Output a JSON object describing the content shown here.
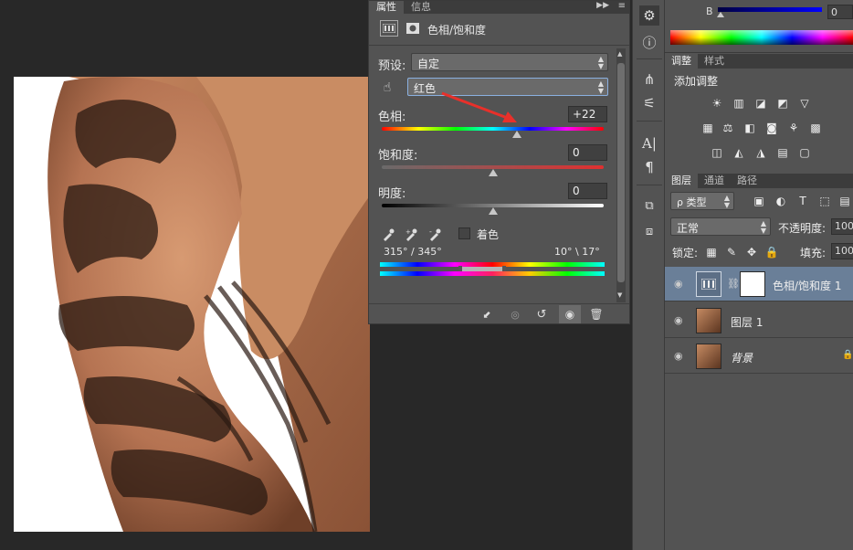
{
  "properties_panel": {
    "tabs": [
      "属性",
      "信息"
    ],
    "title": "色相/饱和度",
    "preset_label": "预设:",
    "preset_value": "自定",
    "channel_value": "红色",
    "hue_label": "色相:",
    "hue_value": "+22",
    "saturation_label": "饱和度:",
    "saturation_value": "0",
    "lightness_label": "明度:",
    "lightness_value": "0",
    "colorize_label": "着色",
    "range_left": "315° / 345°",
    "range_right": "10° \\ 17°",
    "hue_level": 0.61,
    "saturation_level": 0.5,
    "lightness_level": 0.5
  },
  "color_panel": {
    "channel_b_label": "B",
    "channel_b_value": "0"
  },
  "adjustments_panel": {
    "tabs": [
      "调整",
      "样式"
    ],
    "title": "添加调整"
  },
  "layers_panel": {
    "tabs": [
      "图层",
      "通道",
      "路径"
    ],
    "filter_label": "ρ 类型",
    "blend_mode": "正常",
    "opacity_label": "不透明度:",
    "opacity_value": "100",
    "lock_label": "锁定:",
    "fill_label": "填充:",
    "fill_value": "100",
    "layers": [
      {
        "name": "色相/饱和度 1"
      },
      {
        "name": "图层 1"
      },
      {
        "name": "背景"
      }
    ]
  },
  "icons": {
    "eye": "eye-icon",
    "link": "chain-link-icon",
    "lock": "lock-icon"
  }
}
